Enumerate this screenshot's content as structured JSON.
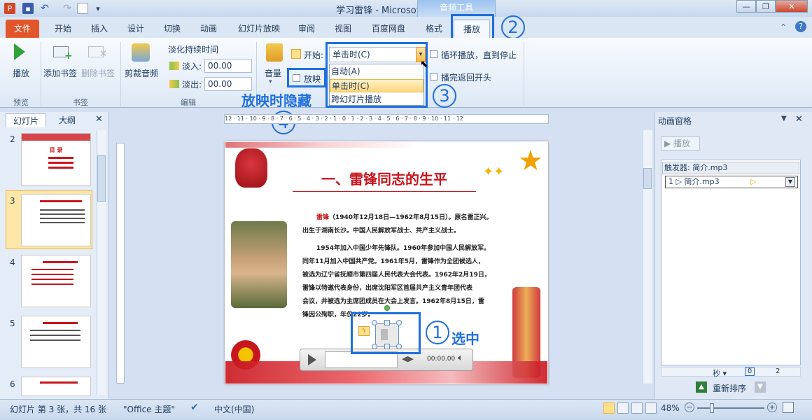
{
  "window": {
    "title": "学习雷锋 - Microsoft PowerPoint",
    "context_tab_group": "音频工具",
    "controls": {
      "minimize": "—",
      "restore": "❐",
      "close": "✕"
    },
    "help": "?"
  },
  "tabs": {
    "file": "文件",
    "items": [
      "开始",
      "插入",
      "设计",
      "切换",
      "动画",
      "幻灯片放映",
      "审阅",
      "视图",
      "百度网盘",
      "格式",
      "播放"
    ]
  },
  "ribbon": {
    "preview": {
      "play": "播放",
      "group": "预览"
    },
    "bookmarks": {
      "add": "添加书签",
      "remove": "删除书签",
      "group": "书签"
    },
    "editing": {
      "trim": "剪裁音频",
      "fade_title": "淡化持续时间",
      "fade_in_label": "淡入:",
      "fade_in_value": "00.00",
      "fade_out_label": "淡出:",
      "fade_out_value": "00.00",
      "group": "编辑"
    },
    "audio_options": {
      "volume": "音量",
      "start_label": "开始:",
      "start_value": "单击时(C)",
      "start_options": [
        "自动(A)",
        "单击时(C)",
        "跨幻灯片播放"
      ],
      "hide_label": "放映",
      "loop_label": "循环播放，直到停止",
      "rewind_label": "播完返回开头"
    }
  },
  "annotations": {
    "num1": "1",
    "label1": "选中",
    "num2": "2",
    "num3": "3",
    "num4": "4",
    "label4": "放映时隐藏"
  },
  "panel": {
    "tab_slides": "幻灯片",
    "tab_outline": "大纲",
    "close": "✕",
    "slide_numbers": [
      "2",
      "3",
      "4",
      "5",
      "6"
    ],
    "thumb2_title": "目 录"
  },
  "ruler": {
    "h_labels": "12 · 11 · 10 · 9 · 8 · 7 · 6 · 5 · 4 · 3 · 2 · 1 · 0 · 1 · 2 · 3 · 4 · 5 · 6 · 7 · 8 · 9 · 10 · 11 · 12"
  },
  "slide": {
    "title": "一、雷锋同志的生平",
    "para1_name": "雷锋",
    "para1_a": "（1940年12月18日—1962年8月15日）。原名雷正兴。",
    "para1_b": "出生于湖南长沙。中国人民解放军战士、共产主义战士。",
    "para2": [
      "1954年加入中国少年先锋队。1960年参加中国人民解放军。",
      "同年11月加入中国共产党。1961年5月，雷锋作为全团候选人，",
      "被选为辽宁省抚顺市第四届人民代表大会代表。1962年2月19日，",
      "雷锋以特邀代表身份，出席沈阳军区首届共产主义青年团代表",
      "会议，并被选为主席团成员在大会上发言。1962年8月15日，雷",
      "锋因公殉职，年仅22岁。"
    ],
    "player_time": "00:00.00"
  },
  "anim_pane": {
    "title": "动画窗格",
    "play": "播放",
    "trigger": "触发器: 简介.mp3",
    "item": "1 ▷ 简介.mp3",
    "seconds": "秒",
    "t0": "0",
    "t2": "2",
    "reorder": "重新排序"
  },
  "status": {
    "slide_info": "幻灯片 第 3 张，共 16 张",
    "theme": "\"Office 主题\"",
    "language": "中文(中国)",
    "zoom": "48%"
  },
  "colors": {
    "accent": "#1f6fde",
    "file_tab": "#e3562c",
    "slide_title": "#c8161d"
  }
}
